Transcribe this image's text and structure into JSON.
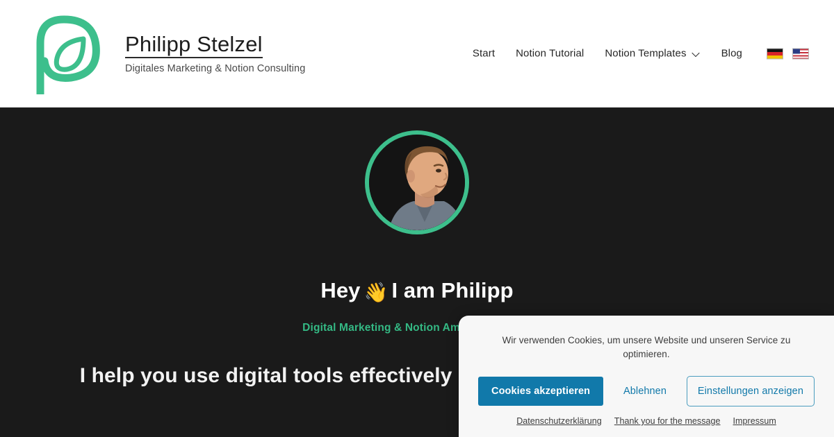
{
  "header": {
    "brand": {
      "logo_icon": "leaf-p-logo",
      "title": "Philipp Stelzel",
      "tagline": "Digitales Marketing & Notion Consulting"
    },
    "nav": {
      "items": [
        {
          "label": "Start",
          "has_dropdown": false
        },
        {
          "label": "Notion Tutorial",
          "has_dropdown": false
        },
        {
          "label": "Notion Templates",
          "has_dropdown": true
        },
        {
          "label": "Blog",
          "has_dropdown": false
        }
      ],
      "languages": [
        {
          "code": "de",
          "icon": "flag-de-icon",
          "label": "Deutsch"
        },
        {
          "code": "en",
          "icon": "flag-us-icon",
          "label": "English"
        }
      ]
    }
  },
  "hero": {
    "avatar_icon": "avatar-portrait",
    "title_prefix": "Hey",
    "title_emoji": "👋",
    "title_suffix": "I am Philipp",
    "subtitle": "Digital Marketing & Notion Ambassador · I h",
    "lead": "I help you use digital tools effectively so that you can increase your"
  },
  "cookie_banner": {
    "message": "Wir verwenden Cookies, um unsere Website und unseren Service zu optimieren.",
    "accept_label": "Cookies akzeptieren",
    "decline_label": "Ablehnen",
    "settings_label": "Einstellungen anzeigen",
    "links": [
      {
        "label": "Datenschutzerklärung"
      },
      {
        "label": "Thank you for the message"
      },
      {
        "label": "Impressum"
      }
    ]
  },
  "colors": {
    "brand_green": "#3dbf8c",
    "accent_green_text": "#34b984",
    "hero_background": "#1a1a1a",
    "header_background": "#ffffff",
    "cookie_background": "#f7f7f7",
    "cookie_blue": "#1179aa"
  }
}
